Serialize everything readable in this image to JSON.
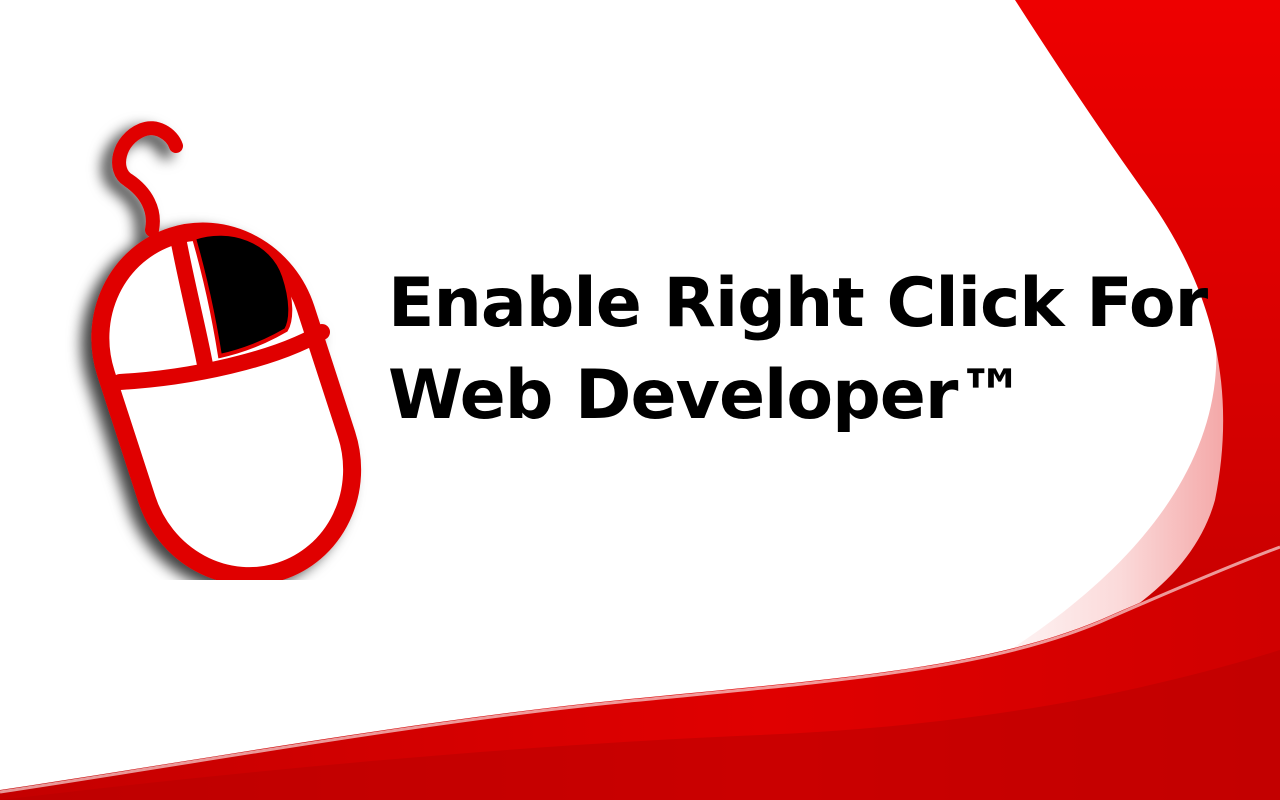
{
  "banner": {
    "title_line1": "Enable Right Click For",
    "title_line2": "Web Developer™"
  },
  "icons": {
    "logo": "computer-mouse-icon"
  },
  "colors": {
    "background": "#ffffff",
    "brand_red": "#e00000",
    "dark_red": "#b00000",
    "light_red": "#f7c5c5",
    "text": "#000000"
  }
}
